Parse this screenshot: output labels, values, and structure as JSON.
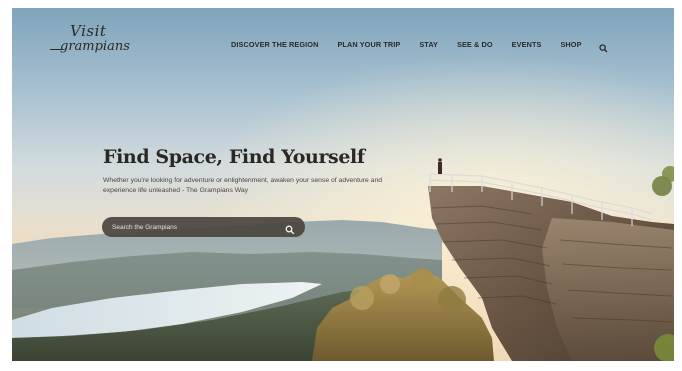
{
  "logo": {
    "line1": "Visit",
    "line2": "grampians"
  },
  "nav": {
    "items": [
      {
        "label": "DISCOVER THE REGION"
      },
      {
        "label": "PLAN YOUR TRIP"
      },
      {
        "label": "STAY"
      },
      {
        "label": "SEE & DO"
      },
      {
        "label": "EVENTS"
      },
      {
        "label": "SHOP"
      }
    ],
    "search_icon": "search-icon"
  },
  "hero": {
    "title": "Find Space, Find Yourself",
    "subtitle": "Whether you're looking for adventure or enlightenment, awaken your sense of adventure and experience life unleashed - The Grampians Way"
  },
  "search": {
    "placeholder": "Search the Grampians",
    "value": "",
    "button_icon": "search-icon"
  },
  "colors": {
    "sky_top": "#7fa5bd",
    "sky_mid": "#c9d6dd",
    "horizon": "#ead8c0",
    "lake": "#dfe9ee",
    "rock": "#6e5a47",
    "text_dark": "#2b2823",
    "search_bg": "#4a443e"
  }
}
